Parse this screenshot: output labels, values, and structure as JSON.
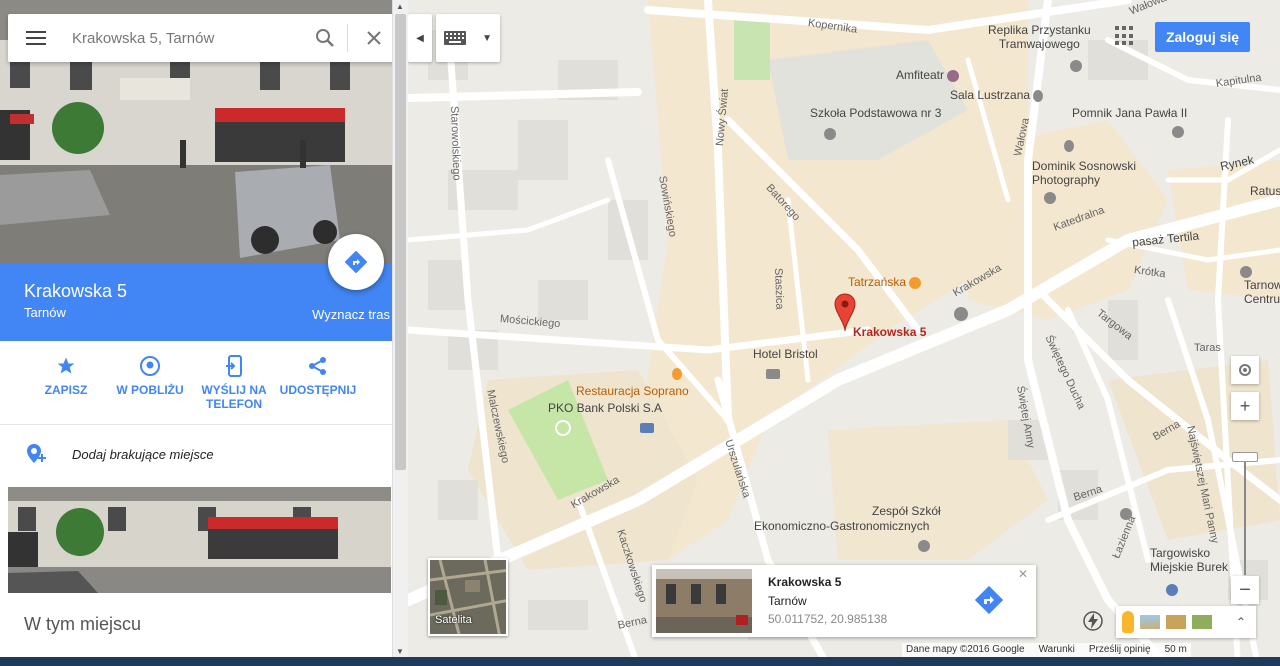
{
  "search": {
    "value": "Krakowska 5, Tarnów"
  },
  "place": {
    "title": "Krakowska 5",
    "subtitle": "Tarnów",
    "route_label": "Wyznacz tras"
  },
  "actions": [
    {
      "label": "ZAPISZ",
      "icon": "star-icon"
    },
    {
      "label": "W POBLIŻU",
      "icon": "nearby-pin-icon"
    },
    {
      "label": "WYŚLIJ NA TELEFON",
      "icon": "send-to-phone-icon"
    },
    {
      "label": "UDOSTĘPNIJ",
      "icon": "share-icon"
    }
  ],
  "add_place": "Dodaj brakujące miejsce",
  "in_place": "W tym miejscu",
  "header": {
    "login": "Zaloguj się"
  },
  "map": {
    "marker_label": "Krakowska 5",
    "pois": {
      "replika1": "Replika Przystanku",
      "replika2": "Tramwajowego",
      "amfiteatr": "Amfiteatr",
      "sala": "Sala Lustrzana",
      "szkola": "Szkoła Podstawowa nr 3",
      "pomnik": "Pomnik Jana Pawła II",
      "dominik1": "Dominik Sosnowski",
      "dominik2": "Photography",
      "tatrzanska": "Tatrzańska",
      "hotel": "Hotel Bristol",
      "restauracja": "Restauracja Soprano",
      "pko": "PKO Bank Polski S.A",
      "zespol1": "Zespół Szkół",
      "zespol2": "Ekonomiczno-Gastronomicznych",
      "targowisko1": "Targowisko",
      "targowisko2": "Miejskie Burek",
      "ratusz": "Ratusz",
      "tarnows1": "Tarnows",
      "tarnows2": "Centrum",
      "pasaz": "pasaż Tertila",
      "rynek": "Rynek"
    },
    "streets": {
      "kopernika": "Kopernika",
      "walowa1": "Wałowa",
      "walowa2": "Wałowa",
      "kapitulna": "Kapitulna",
      "starowolskiego": "Starowolskiego",
      "sowinskiego": "Sowińskiego",
      "nowyswiat": "Nowy Świat",
      "batorego": "Batorego",
      "staszica": "Staszica",
      "krakowska1": "Krakowska",
      "krakowska2": "Krakowska",
      "katedralna": "Katedralna",
      "krotka": "Krótka",
      "moscickiego": "Mościckiego",
      "targowa": "Targowa",
      "taras": "Taras",
      "swietegoducha": "Świętego Ducha",
      "swietejanny": "Świętej Anny",
      "malczewskiego": "Malczewskiego",
      "urszulanska": "Urszulańska",
      "kaczkowskiego": "Kaczkowskiego",
      "berna1": "Berna",
      "berna2": "Berna",
      "berna3": "Berna",
      "lazienna": "Łazienna",
      "najswietszej": "Najświętszej Mari Panny"
    }
  },
  "satellite_label": "Satelita",
  "info_card": {
    "title": "Krakowska 5",
    "subtitle": "Tarnów",
    "coords": "50.011752, 20.985138"
  },
  "footer": {
    "data": "Dane mapy ©2016 Google",
    "terms": "Warunki",
    "feedback": "Prześlij opinię",
    "scale": "50 m"
  }
}
